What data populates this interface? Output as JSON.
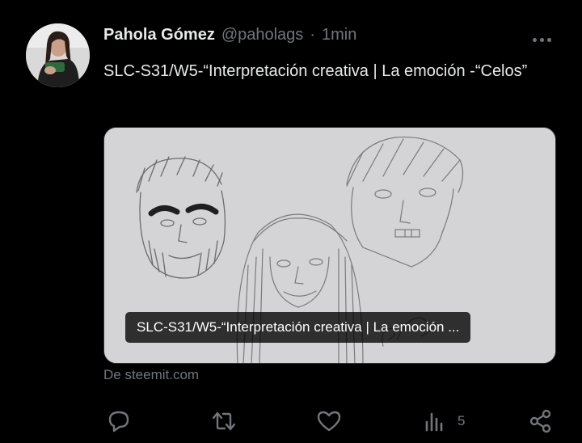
{
  "tweet": {
    "author_name": "Pahola Gómez",
    "handle": "@paholags",
    "separator": "·",
    "time": "1min",
    "text": "SLC-S31/W5-“Interpretación creativa | La emoción -“Celos”"
  },
  "card": {
    "caption": "SLC-S31/W5-“Interpretación creativa | La emoción ...",
    "source": "De steemit.com"
  },
  "actions": {
    "reply_icon": "reply-icon",
    "retweet_icon": "retweet-icon",
    "like_icon": "heart-icon",
    "views_icon": "views-icon",
    "views_count": "5",
    "share_icon": "share-icon"
  },
  "colors": {
    "background": "#000000",
    "text_primary": "#e7e9ea",
    "text_secondary": "#71767b"
  }
}
